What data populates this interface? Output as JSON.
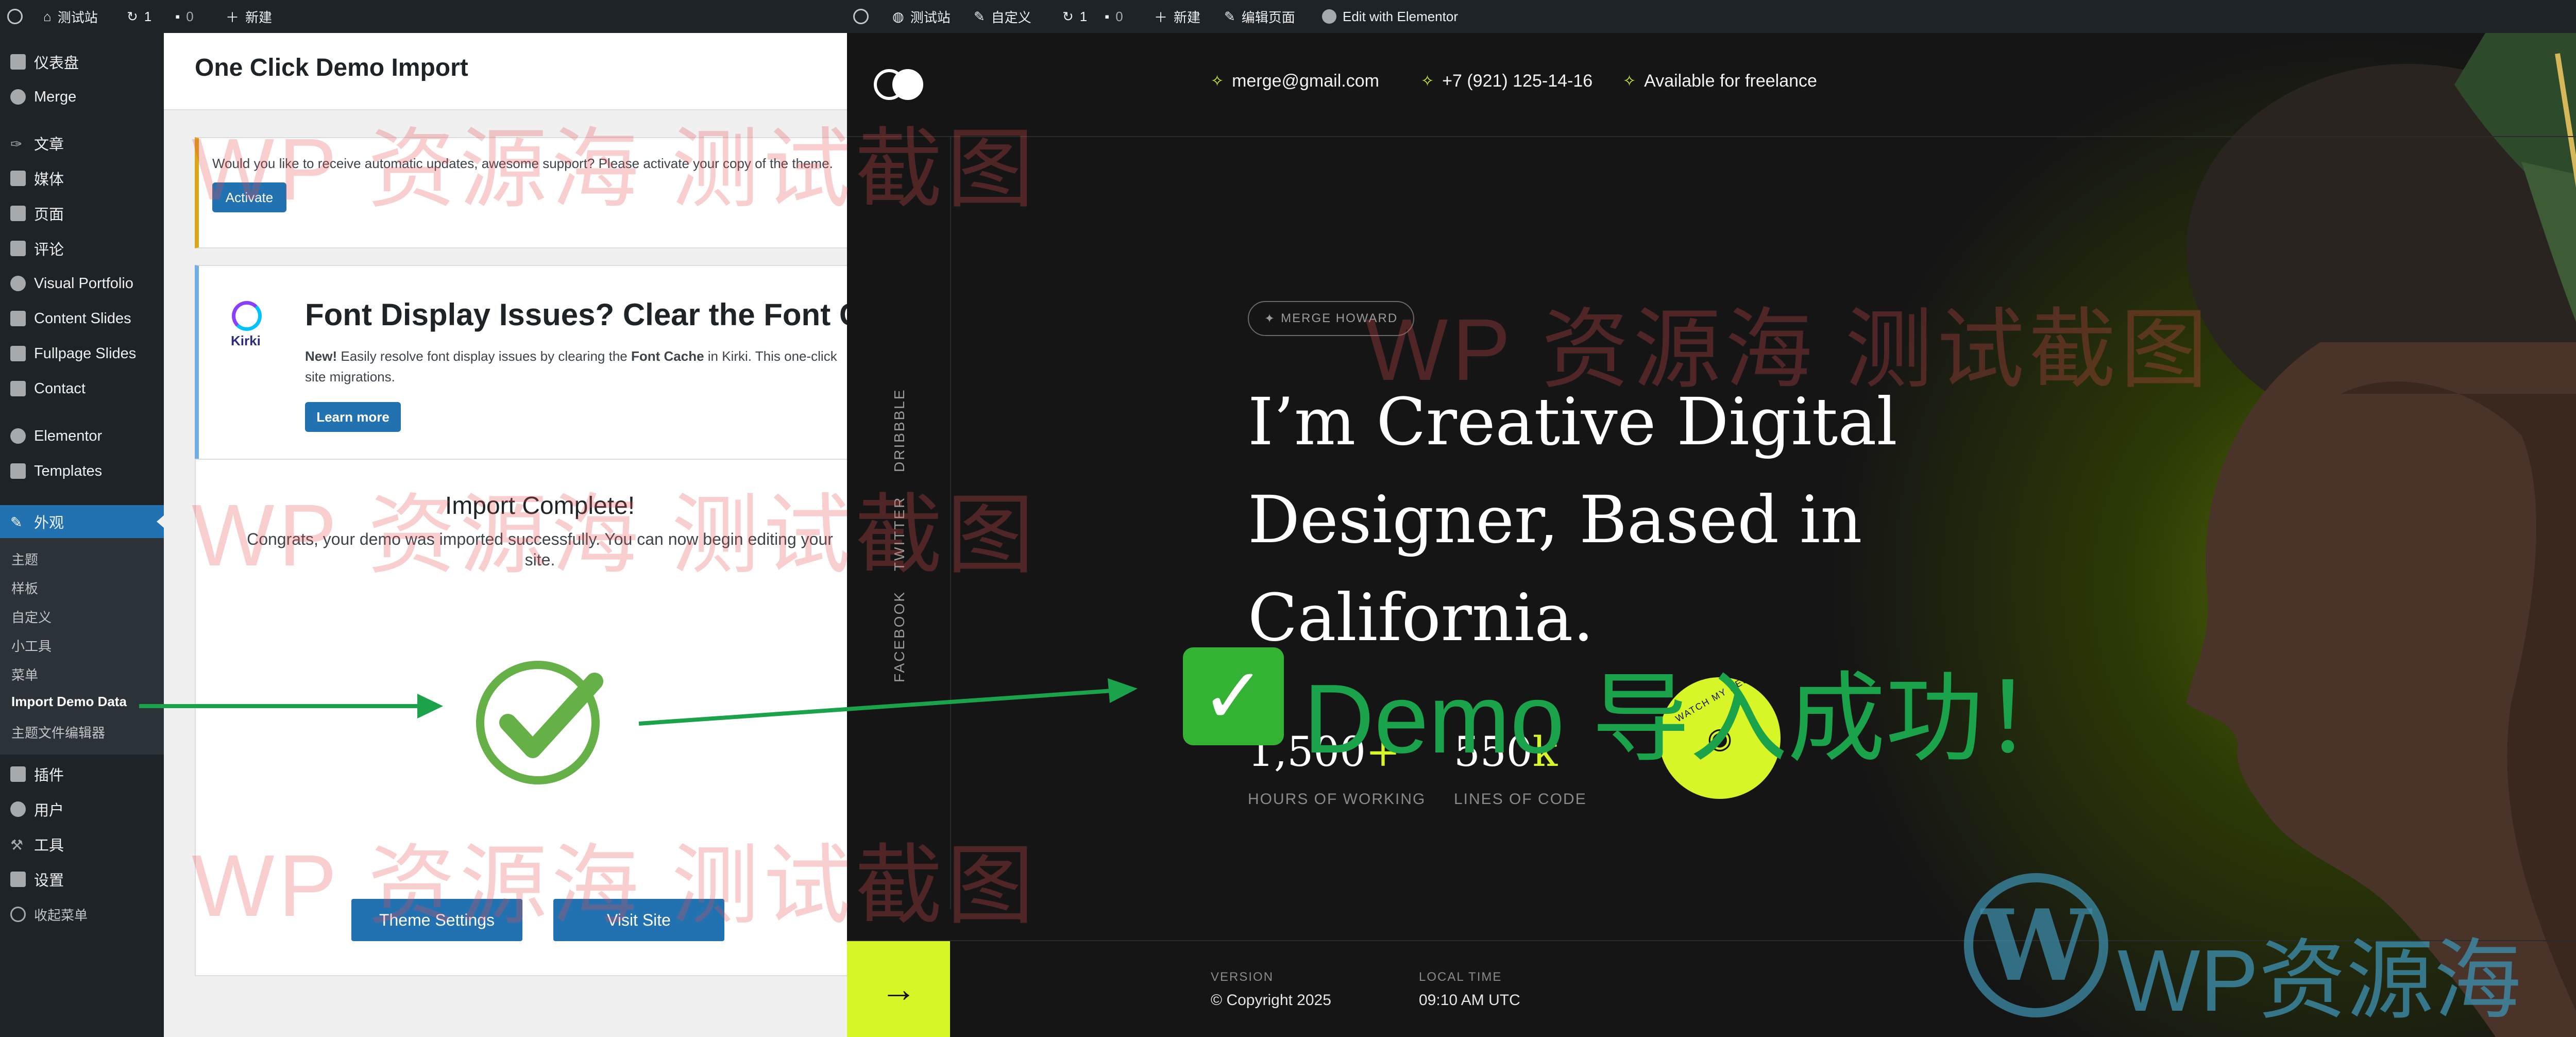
{
  "adminbar_left": {
    "site_name": "测试站",
    "updates_count": "1",
    "comments_count": "0",
    "new_label": "新建"
  },
  "adminbar_right": {
    "site_name": "测试站",
    "customize": "自定义",
    "updates_count": "1",
    "comments_count": "0",
    "new_label": "新建",
    "edit_page": "编辑页面",
    "elementor": "Edit with Elementor"
  },
  "sidebar": {
    "items": [
      {
        "label": "仪表盘"
      },
      {
        "label": "Merge"
      },
      {
        "label": "文章"
      },
      {
        "label": "媒体"
      },
      {
        "label": "页面"
      },
      {
        "label": "评论"
      },
      {
        "label": "Visual Portfolio"
      },
      {
        "label": "Content Slides"
      },
      {
        "label": "Fullpage Slides"
      },
      {
        "label": "Contact"
      },
      {
        "label": "Elementor"
      },
      {
        "label": "Templates"
      },
      {
        "label": "外观"
      }
    ],
    "submenu": [
      "主题",
      "样板",
      "自定义",
      "小工具",
      "菜单",
      "Import Demo Data",
      "主题文件编辑器"
    ],
    "items_after": [
      {
        "label": "插件"
      },
      {
        "label": "用户"
      },
      {
        "label": "工具"
      },
      {
        "label": "设置"
      },
      {
        "label": "收起菜单"
      }
    ]
  },
  "main": {
    "title": "One Click Demo Import",
    "notice_text": "Would you like to receive automatic updates, awesome support? Please activate your copy of the theme.",
    "activate_label": "Activate",
    "kirki": {
      "logo_text": "Kirki",
      "heading": "Font Display Issues? Clear the Font Cache",
      "body_new": "New!",
      "body_1": " Easily resolve font display issues by clearing the ",
      "body_bold": "Font Cache",
      "body_2": " in Kirki. This one-click",
      "body_3": "site migrations.",
      "learn_more": "Learn more"
    },
    "import": {
      "title": "Import Complete!",
      "line1": "Congrats, your demo was imported successfully. You can now begin editing your",
      "line2": "site.",
      "theme_settings": "Theme Settings",
      "visit_site": "Visit Site"
    }
  },
  "site": {
    "email": "merge@gmail.com",
    "phone": "+7 (921) 125-14-16",
    "availability": "Available for freelance",
    "social": [
      "DRIBBBLE",
      "TWITTER",
      "FACEBOOK"
    ],
    "tag": "MERGE HOWARD",
    "headline": [
      "I’m Creative Digital",
      "Designer, Based in",
      "California."
    ],
    "stat1_num": "1,500",
    "stat1_suffix": "+",
    "stat1_label": "HOURS OF WORKING",
    "stat2_num": "550",
    "stat2_suffix": "k",
    "stat2_label": "LINES OF CODE",
    "badge_text": "WATCH MY RESUME",
    "version_label": "VERSION",
    "version_value": "© Copyright 2025",
    "time_label": "LOCAL TIME",
    "time_value": "09:10 AM UTC"
  },
  "overlay": {
    "success_text": "Demo 导入成功！",
    "watermark": "WP 资源海 测试截图",
    "logo_text": "WP资源海"
  },
  "colors": {
    "wp_blue": "#2271b1",
    "accent_lime": "#d8f527",
    "success_green": "#1aa34a"
  }
}
